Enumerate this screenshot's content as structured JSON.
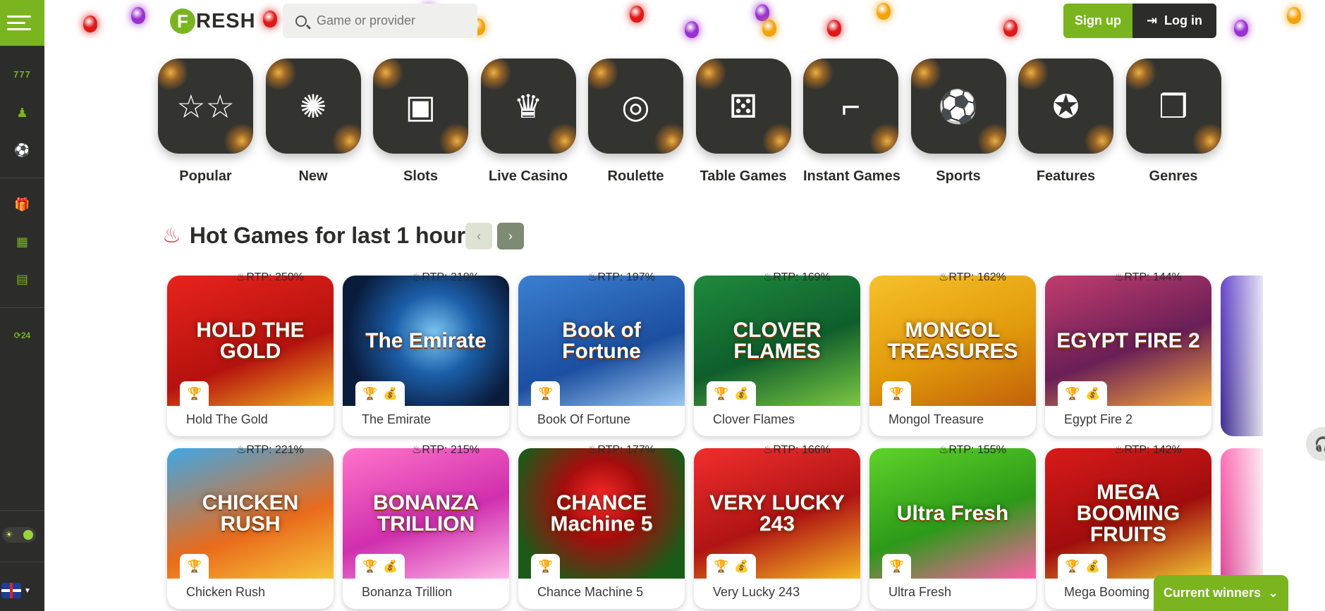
{
  "colors": {
    "accent": "#7ab41f",
    "dark": "#2c2c2a",
    "hot": "#e8365a"
  },
  "header": {
    "logo_initial": "F",
    "logo_text": "RESH",
    "search_placeholder": "Game or provider",
    "signup_label": "Sign up",
    "login_label": "Log in"
  },
  "sidebar": {
    "items": [
      "slots-icon",
      "live-casino-icon",
      "sports-icon",
      "gift-icon",
      "calendar-icon",
      "news-icon",
      "support-24-icon"
    ]
  },
  "categories": [
    {
      "label": "Popular",
      "icon": "stars-icon"
    },
    {
      "label": "New",
      "icon": "new-badge-icon"
    },
    {
      "label": "Slots",
      "icon": "slot-machine-icon"
    },
    {
      "label": "Live Casino",
      "icon": "dealer-icon"
    },
    {
      "label": "Roulette",
      "icon": "roulette-icon"
    },
    {
      "label": "Table Games",
      "icon": "dice-icon"
    },
    {
      "label": "Instant Games",
      "icon": "curve-chart-icon"
    },
    {
      "label": "Sports",
      "icon": "soccer-ball-icon"
    },
    {
      "label": "Features",
      "icon": "award-icon"
    },
    {
      "label": "Genres",
      "icon": "cubes-icon"
    }
  ],
  "hot": {
    "title": "Hot Games for last 1 hour"
  },
  "games_row1": [
    {
      "name": "Hold The Gold",
      "rtp": "RTP: 250%",
      "art": "HOLD THE GOLD",
      "bg": "linear-gradient(160deg,#e8231c,#b5120f 60%,#f2b01e)"
    },
    {
      "name": "The Emirate",
      "rtp": "RTP: 218%",
      "art": "The Emirate",
      "bg": "radial-gradient(circle at 55% 45%,#7ec8f5 0%,#1b5ea8 35%,#0a1c3c 75%)"
    },
    {
      "name": "Book Of Fortune",
      "rtp": "RTP: 197%",
      "art": "Book of Fortune",
      "bg": "linear-gradient(160deg,#3a7fd1,#1c4fa0 60%,#9cc8f0)"
    },
    {
      "name": "Clover Flames",
      "rtp": "RTP: 169%",
      "art": "CLOVER FLAMES",
      "bg": "linear-gradient(160deg,#1f8a3c,#0f5e2c 55%,#7cc742)"
    },
    {
      "name": "Mongol Treasure",
      "rtp": "RTP: 162%",
      "art": "MONGOL TREASURES",
      "bg": "linear-gradient(160deg,#f6c12b,#e29a0b 55%,#c0610a)"
    },
    {
      "name": "Egypt Fire 2",
      "rtp": "RTP: 144%",
      "art": "EGYPT FIRE 2",
      "bg": "linear-gradient(160deg,#c13d6d,#6a1f57 55%,#f2a63a)"
    }
  ],
  "games_row2": [
    {
      "name": "Chicken Rush",
      "rtp": "RTP: 221%",
      "art": "CHICKEN RUSH",
      "bg": "linear-gradient(160deg,#3fa8e6,#e96b1b 60%,#f7c43a)"
    },
    {
      "name": "Bonanza Trillion",
      "rtp": "RTP: 215%",
      "art": "BONANZA TRILLION",
      "bg": "linear-gradient(160deg,#ff74c9,#d02fae 55%,#ffb8e8)"
    },
    {
      "name": "Chance Machine 5",
      "rtp": "RTP: 177%",
      "art": "CHANCE Machine 5",
      "bg": "radial-gradient(circle at 50% 40%,#ff2a2a 0%,#a50d0d 35%,#1c5a18 80%)"
    },
    {
      "name": "Very Lucky 243",
      "rtp": "RTP: 166%",
      "art": "VERY LUCKY 243",
      "bg": "linear-gradient(160deg,#f22e2e,#b01414 55%,#f6b822)"
    },
    {
      "name": "Ultra Fresh",
      "rtp": "RTP: 155%",
      "art": "Ultra Fresh",
      "bg": "linear-gradient(160deg,#5fd32a,#2c9a18 55%,#ff5fa8)"
    },
    {
      "name": "Mega Booming",
      "rtp": "RTP: 142%",
      "art": "MEGA BOOMING FRUITS",
      "bg": "linear-gradient(160deg,#d91a1a,#a00d0d 55%,#f2c432)"
    }
  ],
  "widgets": {
    "current_winners_label": "Current winners"
  }
}
